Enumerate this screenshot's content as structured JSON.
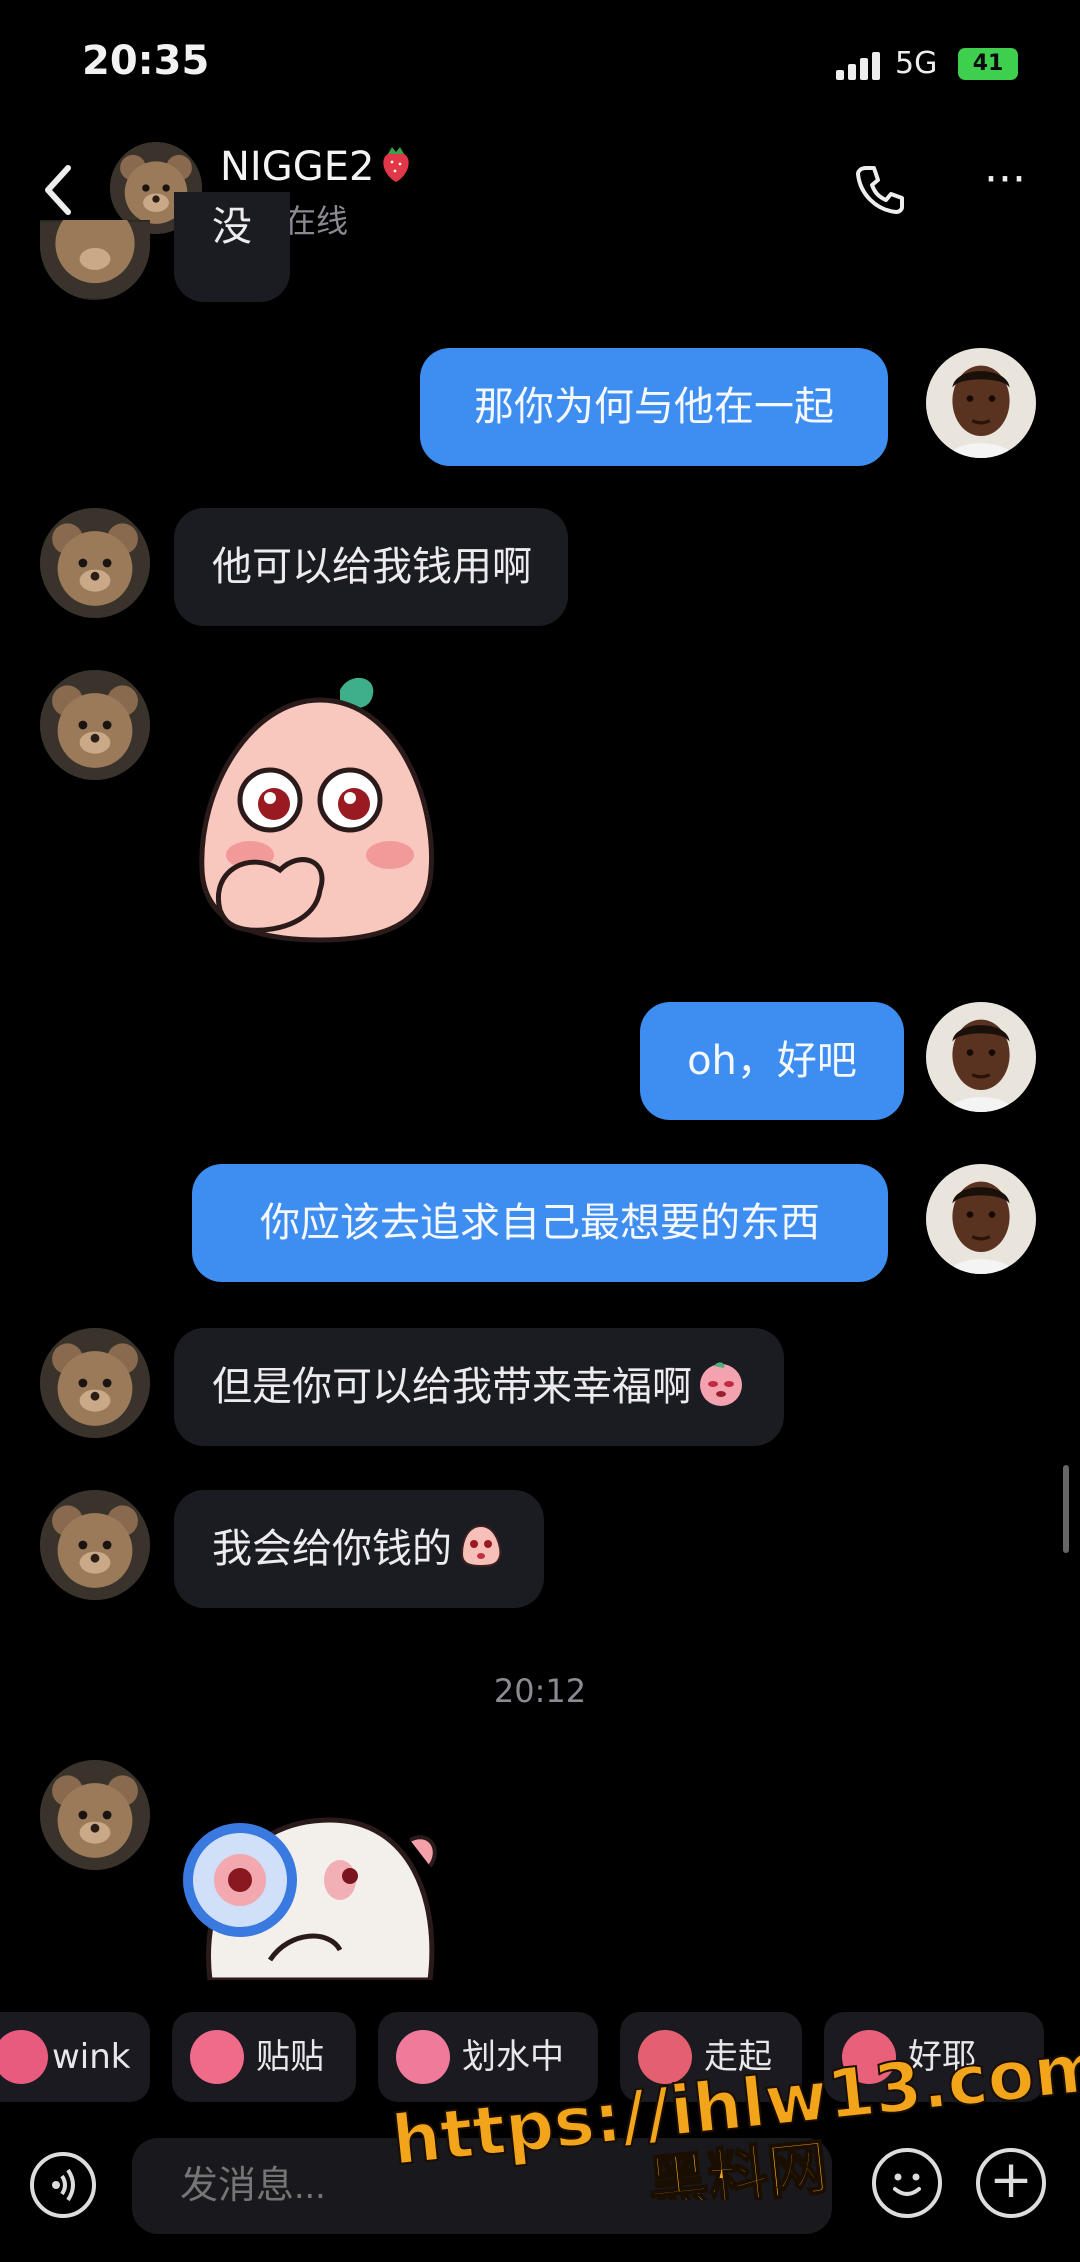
{
  "status_bar": {
    "time": "20:35",
    "network": "5G",
    "battery": "41"
  },
  "header": {
    "contact_name": "NIGGE2",
    "status": "当前在线",
    "back_icon": "chevron-left-icon",
    "call_icon": "phone-icon",
    "more_icon": "more-icon"
  },
  "messages": [
    {
      "side": "in",
      "text": "没"
    },
    {
      "side": "out",
      "text": "那你为何与他在一起"
    },
    {
      "side": "in",
      "text": "他可以给我钱用啊"
    },
    {
      "side": "in",
      "type": "sticker",
      "sticker": "peach-shy-sticker"
    },
    {
      "side": "out",
      "text": "oh，好吧"
    },
    {
      "side": "out",
      "text": "你应该去追求自己最想要的东西"
    },
    {
      "side": "in",
      "text": "但是你可以给我带来幸福啊"
    },
    {
      "side": "in",
      "text": "我会给你钱的"
    },
    {
      "side": "in",
      "type": "sticker",
      "sticker": "magnifier-sticker"
    }
  ],
  "timestamp": "20:12",
  "quick_replies": [
    {
      "label": "wink",
      "color": "#e85a7e"
    },
    {
      "label": "贴贴",
      "color": "#f06a8a"
    },
    {
      "label": "划水中",
      "color": "#f07a9a"
    },
    {
      "label": "走起",
      "color": "#e46070"
    },
    {
      "label": "好耶",
      "color": "#e8607a"
    }
  ],
  "input": {
    "placeholder": "发消息..."
  },
  "watermark": {
    "line1": "https://ihlw13.com",
    "line2": "黑料网"
  }
}
